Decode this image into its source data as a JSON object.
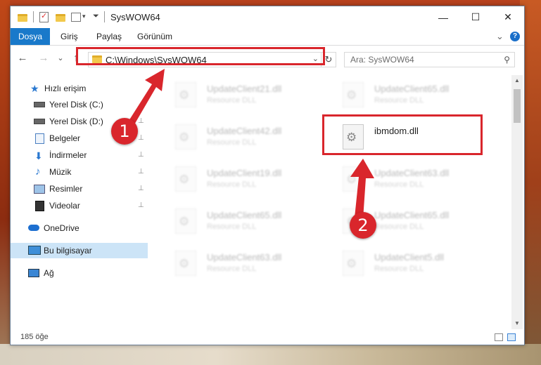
{
  "window": {
    "title": "SysWOW64",
    "minimize_glyph": "—",
    "maximize_glyph": "☐",
    "close_glyph": "✕"
  },
  "ribbon": {
    "tabs": [
      "Dosya",
      "Giriş",
      "Paylaş",
      "Görünüm"
    ],
    "expand_glyph": "⌄",
    "help_glyph": "?"
  },
  "address_bar": {
    "path": "C:\\Windows\\SysWOW64",
    "dropdown_glyph": "⌄",
    "refresh_glyph": "↻"
  },
  "search": {
    "placeholder": "Ara: SysWOW64",
    "icon": "search-icon"
  },
  "nav_buttons": {
    "back": "←",
    "forward": "→",
    "recent": "⌄",
    "up": "↑"
  },
  "sidebar": {
    "items": [
      {
        "label": "Hızlı erişim",
        "icon": "star-icon"
      },
      {
        "label": "Yerel Disk (C:)",
        "icon": "drive-icon"
      },
      {
        "label": "Yerel Disk (D:)",
        "icon": "drive-icon"
      },
      {
        "label": "Belgeler",
        "icon": "documents-icon",
        "pinned": true
      },
      {
        "label": "İndirmeler",
        "icon": "download-icon",
        "pinned": true
      },
      {
        "label": "Müzik",
        "icon": "music-icon",
        "pinned": true
      },
      {
        "label": "Resimler",
        "icon": "pictures-icon",
        "pinned": true
      },
      {
        "label": "Videolar",
        "icon": "video-icon",
        "pinned": true
      },
      {
        "label": "OneDrive",
        "icon": "cloud-icon"
      },
      {
        "label": "Bu bilgisayar",
        "icon": "computer-icon",
        "selected": true
      },
      {
        "label": "Ağ",
        "icon": "network-icon"
      }
    ],
    "pin_glyph": "📌"
  },
  "files": [
    {
      "name": "UpdateClient21.dll",
      "desc": "Resource DLL",
      "faded": true
    },
    {
      "name": "UpdateClient65.dll",
      "desc": "Resource DLL",
      "faded": true
    },
    {
      "name": "UpdateClient42.dll",
      "desc": "Resource DLL",
      "faded": true
    },
    {
      "name": "ibmdom.dll",
      "desc": "",
      "faded": false
    },
    {
      "name": "UpdateClient19.dll",
      "desc": "Resource DLL",
      "faded": true
    },
    {
      "name": "UpdateClient63.dll",
      "desc": "Resource DLL",
      "faded": true
    },
    {
      "name": "UpdateClient65.dll",
      "desc": "Resource DLL",
      "faded": true
    },
    {
      "name": "UpdateClient65.dll",
      "desc": "Resource DLL",
      "faded": true
    },
    {
      "name": "UpdateClient63.dll",
      "desc": "Resource DLL",
      "faded": true
    },
    {
      "name": "UpdateClient5.dll",
      "desc": "Resource DLL",
      "faded": true
    }
  ],
  "status": {
    "item_count": "185 öğe"
  },
  "callouts": {
    "step1": "1",
    "step2": "2",
    "color": "#d9262c"
  }
}
